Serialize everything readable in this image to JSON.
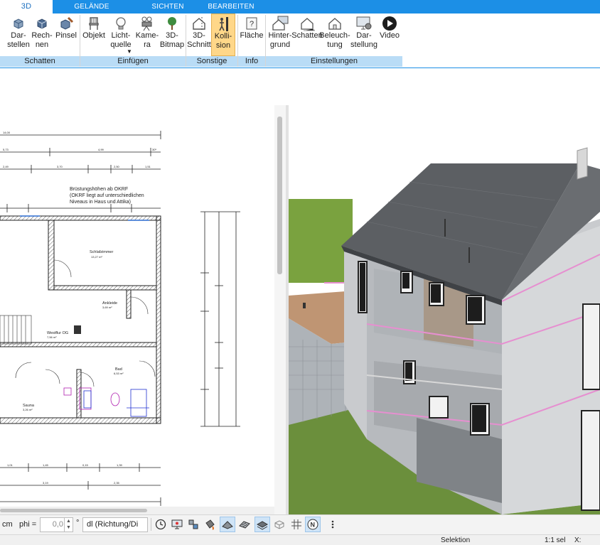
{
  "ribbon": {
    "tabs": [
      {
        "label": "3D",
        "active": true
      },
      {
        "label": "GELÄNDE",
        "active": false
      },
      {
        "label": "SICHTEN",
        "active": false
      },
      {
        "label": "BEARBEITEN",
        "active": false
      }
    ],
    "buttons": [
      {
        "label": "Dar-\nstellen",
        "icon": "cube-display-icon"
      },
      {
        "label": "Rech-\nnen",
        "icon": "cube-calculate-icon"
      },
      {
        "label": "Pinsel",
        "icon": "cube-brush-icon"
      },
      {
        "label": "Objekt",
        "icon": "chair-icon"
      },
      {
        "label": "Licht-\nquelle",
        "icon": "lightbulb-icon"
      },
      {
        "label": "Kame-\nra",
        "icon": "camera-icon"
      },
      {
        "label": "3D-\nBitmap",
        "icon": "tree-icon"
      },
      {
        "label": "3D-\nSchnitt",
        "icon": "house-section-icon"
      },
      {
        "label": "Kolli-\nsion",
        "icon": "collision-person-icon",
        "active": true
      },
      {
        "label": "Fläche",
        "icon": "area-help-icon"
      },
      {
        "label": "Hinter-\ngrund",
        "icon": "house-background-icon"
      },
      {
        "label": "Schatten",
        "icon": "house-shadow-icon"
      },
      {
        "label": "Beleuch-\ntung",
        "icon": "house-lighting-icon"
      },
      {
        "label": "Dar-\nstellung",
        "icon": "monitor-settings-icon"
      },
      {
        "label": "Video",
        "icon": "video-play-icon"
      }
    ],
    "groups": [
      "Schatten",
      "Einfügen",
      "Sonstige",
      "Info",
      "Einstellungen"
    ]
  },
  "plan": {
    "note_lines": [
      "Brüstungshöhen ab OKRF",
      "(OKRF liegt auf unterschiedlichen",
      "Niveaus in Haus und Attika)"
    ],
    "rooms": [
      {
        "name": "Schlafzimmer",
        "area": "13,27 m²"
      },
      {
        "name": "Ankleide",
        "area": "3,69 m²"
      },
      {
        "name": "Westflur OG",
        "area": "7,56 m²"
      },
      {
        "name": "Bad",
        "area": "6,53 m²"
      },
      {
        "name": "Sauna",
        "area": "3,26 m²"
      }
    ]
  },
  "bottombar": {
    "unit": "cm",
    "phi_label": "phi =",
    "phi_value": "0,0",
    "degree": "°",
    "mode_combo": "dl (Richtung/Di",
    "tools": [
      "clock-icon",
      "monitor-icon",
      "transfer-icon",
      "paint-bucket-icon",
      "plane-tilt-icon",
      "surface-hatch-icon",
      "layer-stack-icon",
      "wireframe-icon",
      "grid-icon",
      "north-icon",
      "more-options-icon"
    ]
  },
  "status": {
    "mode": "Selektion",
    "scale": "1:1 sel",
    "x_label": "X:"
  },
  "colors": {
    "ribbon_blue": "#1c8fe6",
    "group_bar": "#b9dcf6",
    "active_button": "#ffd789",
    "grass": "#6b8f3c",
    "roof": "#5c5f63",
    "wall": "#c9cbce",
    "highlight_pink": "#e68fd0"
  }
}
